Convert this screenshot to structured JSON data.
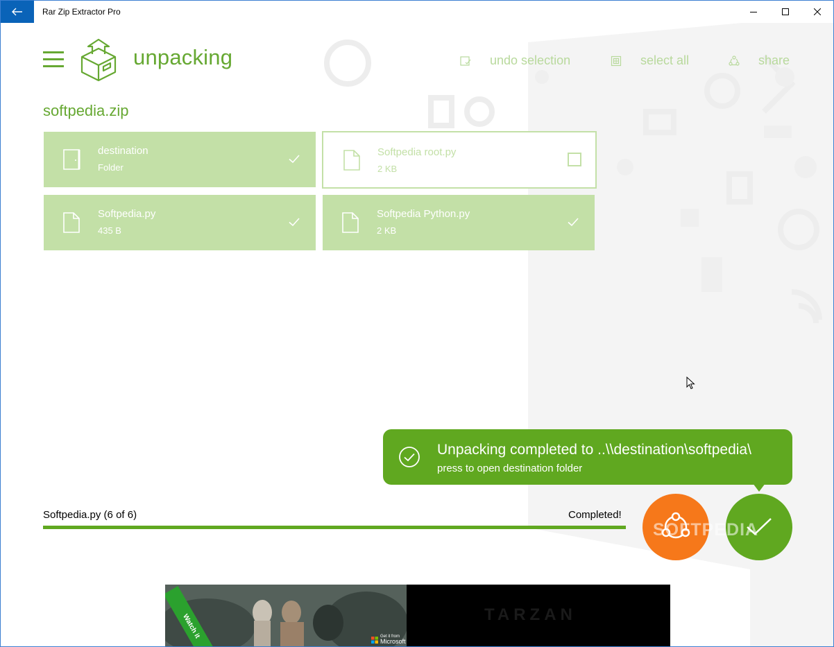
{
  "window": {
    "title": "Rar Zip Extractor Pro"
  },
  "header": {
    "heading": "unpacking",
    "commands": [
      {
        "label": "undo selection",
        "icon": "undo-selection-icon"
      },
      {
        "label": "select all",
        "icon": "select-all-icon"
      },
      {
        "label": "share",
        "icon": "share-icon"
      }
    ]
  },
  "archive": {
    "name": "softpedia.zip",
    "items": [
      {
        "name": "destination",
        "detail": "Folder",
        "type": "folder",
        "selected": true
      },
      {
        "name": "Softpedia root.py",
        "detail": "2 KB",
        "type": "file",
        "selected": false
      },
      {
        "name": "Softpedia.py",
        "detail": "435 B",
        "type": "file",
        "selected": true
      },
      {
        "name": "Softpedia Python.py",
        "detail": "2 KB",
        "type": "file",
        "selected": true
      }
    ]
  },
  "progress": {
    "file_label": "Softpedia.py (6 of 6)",
    "status": "Completed!",
    "fraction": 1.0
  },
  "toast": {
    "title": "Unpacking completed to ..\\\\destination\\softpedia\\",
    "subtitle": "press to open destination folder"
  },
  "watermark": "SOFTPEDIA",
  "ad": {
    "ribbon": "Watch it",
    "badge_small": "Get it from",
    "badge_brand": "Microsoft",
    "title": "TARZAN"
  },
  "colors": {
    "accent": "#66a832",
    "tile": "#c3e0a7",
    "toast": "#60a820",
    "share_fab": "#f6781a",
    "titlebar_back": "#0a63b8"
  }
}
